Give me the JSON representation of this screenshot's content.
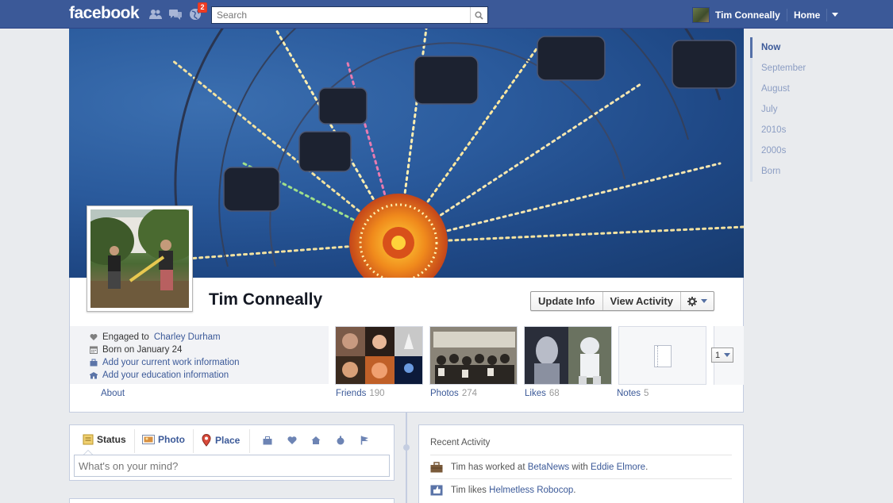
{
  "topbar": {
    "logo": "facebook",
    "notification_count": "2",
    "search_placeholder": "Search",
    "user_name": "Tim Conneally",
    "home_label": "Home"
  },
  "profile": {
    "name": "Tim Conneally",
    "buttons": {
      "update_info": "Update Info",
      "view_activity": "View Activity"
    },
    "info": {
      "engaged_prefix": "Engaged to",
      "engaged_to": "Charley Durham",
      "born": "Born on January 24",
      "add_work": "Add your current work information",
      "add_education": "Add your education information"
    },
    "about_label": "About",
    "tiles": [
      {
        "label": "Friends",
        "count": "190"
      },
      {
        "label": "Photos",
        "count": "274"
      },
      {
        "label": "Likes",
        "count": "68"
      },
      {
        "label": "Notes",
        "count": "5"
      }
    ],
    "page_select_value": "1"
  },
  "composer": {
    "tabs": {
      "status": "Status",
      "photo": "Photo",
      "place": "Place"
    },
    "placeholder": "What's on your mind?"
  },
  "recent_activity": {
    "title": "Recent Activity",
    "row1": {
      "prefix": "Tim has worked at",
      "company": "BetaNews",
      "mid": "with",
      "person": "Eddie Elmore",
      "suffix": "."
    },
    "row2": {
      "prefix": "Tim likes",
      "page": "Helmetless Robocop",
      "suffix": "."
    }
  },
  "scrubber": [
    "Now",
    "September",
    "August",
    "July",
    "2010s",
    "2000s",
    "Born"
  ],
  "colors": {
    "brand": "#3b5998",
    "badge": "#f03d25",
    "background": "#e9ebee"
  }
}
